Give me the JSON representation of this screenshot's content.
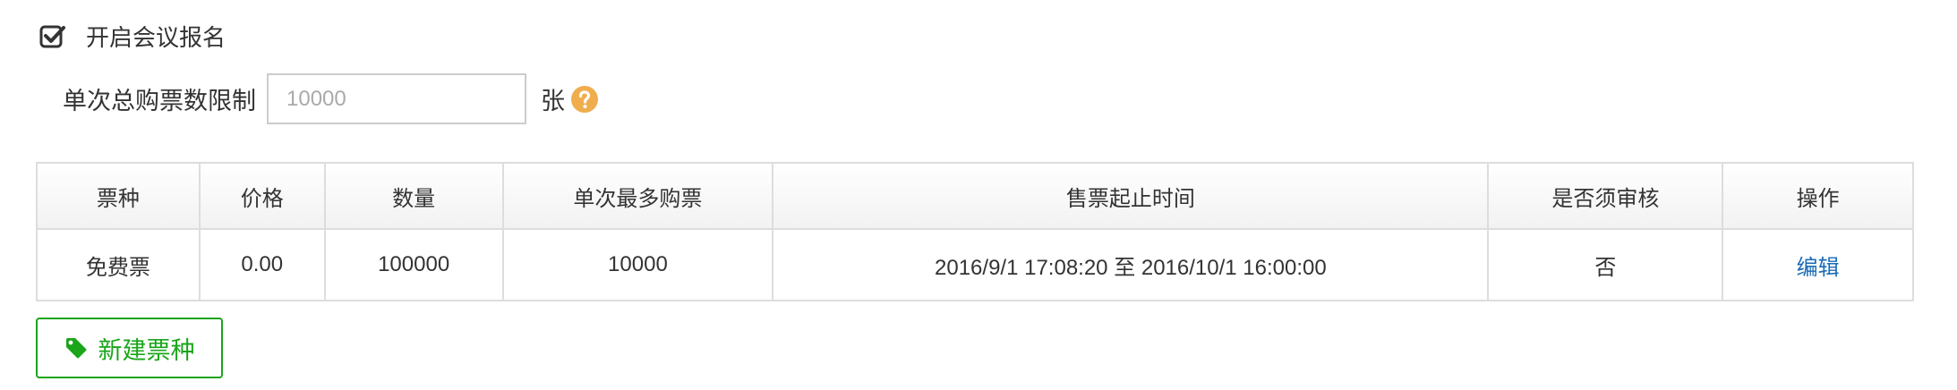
{
  "signup": {
    "checked": true,
    "label": "开启会议报名"
  },
  "limit": {
    "label": "单次总购票数限制",
    "placeholder": "10000",
    "unit": "张",
    "help_icon": "question-circle-icon"
  },
  "table": {
    "headers": [
      "票种",
      "价格",
      "数量",
      "单次最多购票",
      "售票起止时间",
      "是否须审核",
      "操作"
    ],
    "rows": [
      {
        "type": "免费票",
        "price": "0.00",
        "quantity": "100000",
        "max_per_order": "10000",
        "sale_period": "2016/9/1 17:08:20 至 2016/10/1 16:00:00",
        "needs_review": "否",
        "action": "编辑"
      }
    ]
  },
  "new_button": {
    "label": "新建票种",
    "icon": "tag-icon"
  },
  "colors": {
    "accent_green": "#1aa51a",
    "help_orange": "#f0ad4e",
    "link_blue": "#1a6bb5",
    "border": "#dddddd"
  }
}
